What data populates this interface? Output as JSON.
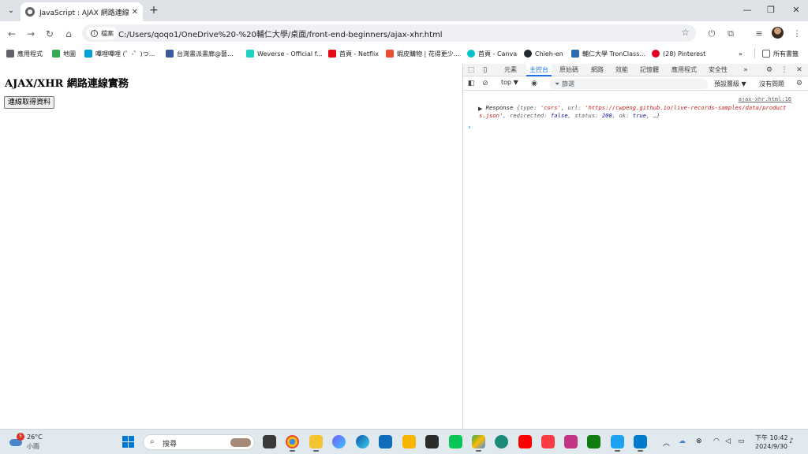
{
  "browser": {
    "tab_title": "JavaScript : AJAX 網路連線實務",
    "address": {
      "site_label": "檔案",
      "url": "C:/Users/qoqo1/OneDrive%20-%20輔仁大學/桌面/front-end-beginners/ajax-xhr.html"
    },
    "bookmarks": [
      {
        "label": "應用程式",
        "color": "#5f6368"
      },
      {
        "label": "地圖",
        "color": "#34a853"
      },
      {
        "label": "嗶哩嗶哩 (゜-゜)つ...",
        "color": "#00a1d6"
      },
      {
        "label": "台灣畫派畫廊@藝...",
        "color": "#3b5998"
      },
      {
        "label": "Weverse - Official f...",
        "color": "#1fd1c1"
      },
      {
        "label": "首頁 - Netflix",
        "color": "#e50914"
      },
      {
        "label": "蝦皮購物 | 花得更少...",
        "color": "#ee4d2d"
      },
      {
        "label": "首頁 - Canva",
        "color": "#00c4cc"
      },
      {
        "label": "Chieh-en",
        "color": "#24292f"
      },
      {
        "label": "輔仁大學 TronClass...",
        "color": "#2b6cb0"
      },
      {
        "label": "(28) Pinterest",
        "color": "#e60023"
      }
    ],
    "all_bookmarks": "所有書籤"
  },
  "page": {
    "heading": "AJAX/XHR 網路連線實務",
    "button_label": "連線取得資料"
  },
  "devtools": {
    "tabs": [
      "元素",
      "主控台",
      "原始碼",
      "網路",
      "效能",
      "記憶體",
      "應用程式",
      "安全性"
    ],
    "active_tab": "主控台",
    "context": "top ▼",
    "filter_placeholder": "篩選",
    "level": "預設層級 ▼",
    "issues": "沒有問題",
    "source_link": "ajax-xhr.html:16",
    "log": {
      "class_name": "Response",
      "type_key": "type",
      "type_val": "'cors'",
      "url_key": "url",
      "url_val": "'https://cwpeng.github.io/live-records-samples/data/products.json'",
      "redirected_key": "redirected",
      "redirected_val": "false",
      "status_key": "status",
      "status_val": "200",
      "ok_key": "ok",
      "ok_val": "true",
      "more": "…"
    }
  },
  "taskbar": {
    "weather_badge": "5",
    "temperature": "26°C",
    "condition": "小雨",
    "search_placeholder": "搜尋",
    "time": "下午 10:42",
    "date": "2024/9/30"
  }
}
